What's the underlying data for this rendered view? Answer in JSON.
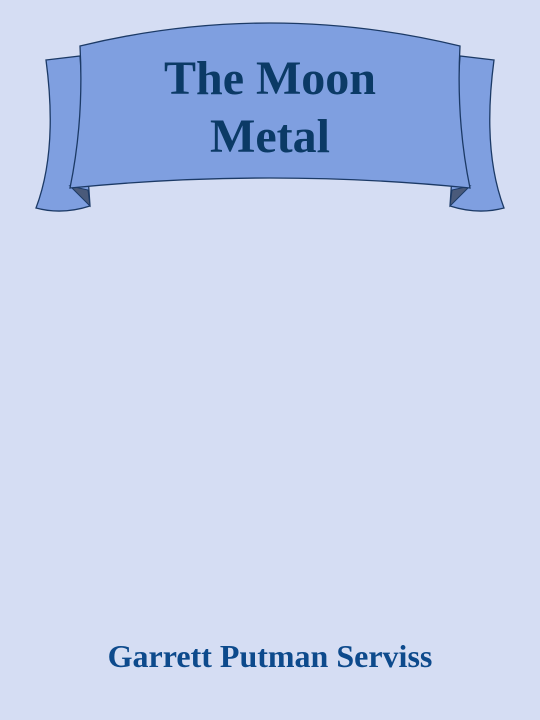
{
  "book": {
    "title_lines": [
      "The Moon",
      "Metal"
    ],
    "author": "Garrett Putman Serviss"
  },
  "colors": {
    "background": "#d5ddf3",
    "banner_fill": "#7f9fe0",
    "banner_shadow": "#4a5a7a",
    "banner_stroke": "#1c3a66",
    "title_text": "#0b3a66",
    "author_text": "#0d4a8c"
  }
}
